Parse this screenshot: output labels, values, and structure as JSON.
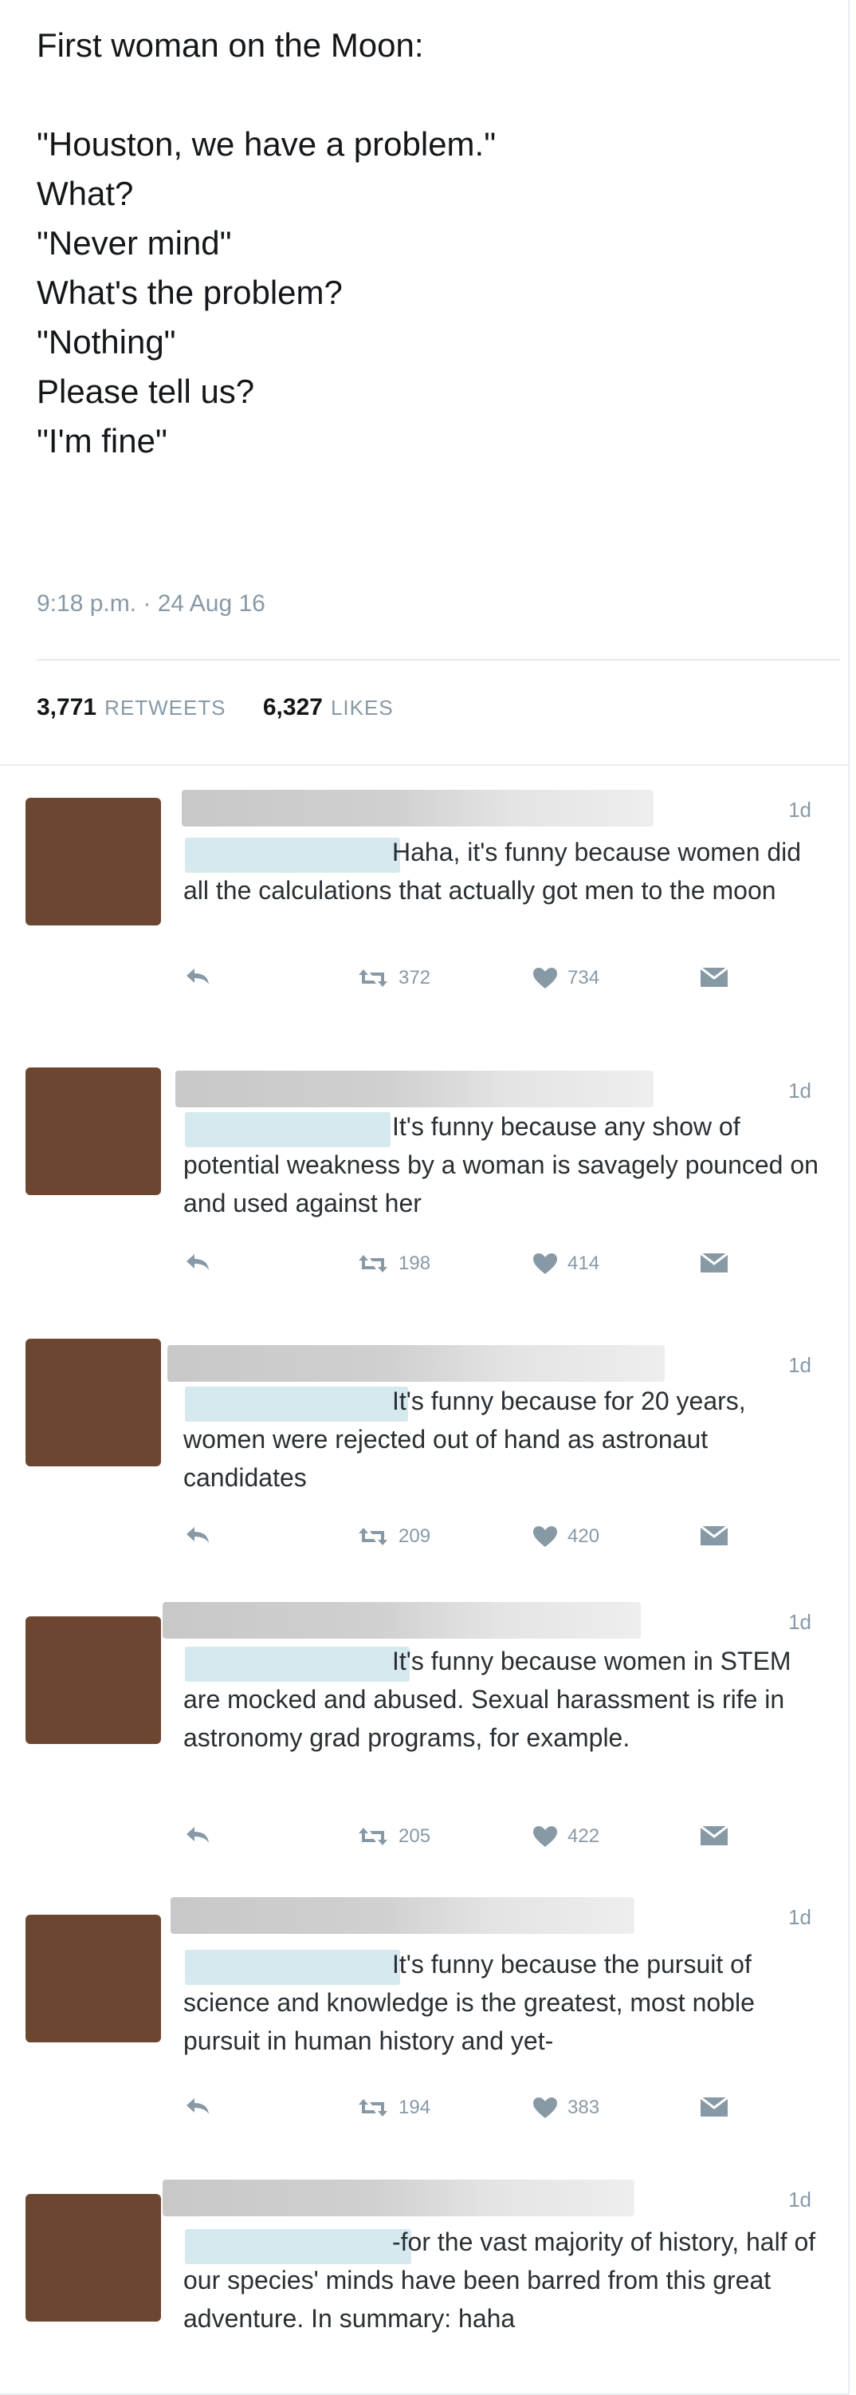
{
  "tweet": {
    "lines": [
      "First woman on the Moon:",
      "\"Houston, we have a problem.\"",
      "What?",
      "\"Never mind\"",
      "What's the problem?",
      "\"Nothing\"",
      "Please tell us?",
      "\"I'm fine\""
    ],
    "timestamp": "9:18 p.m. · 24 Aug 16",
    "retweets_count": "3,771",
    "retweets_label": "RETWEETS",
    "likes_count": "6,327",
    "likes_label": "LIKES"
  },
  "replies": [
    {
      "age": "1d",
      "text": "Haha, it's funny because women did all the calculations that actually got men to the moon",
      "retweets": "372",
      "likes": "734"
    },
    {
      "age": "1d",
      "text": "It's funny because any show of potential weakness by a woman is savagely pounced on and used against her",
      "retweets": "198",
      "likes": "414"
    },
    {
      "age": "1d",
      "text": "It's funny because for 20 years, women were rejected out of hand as astronaut candidates",
      "retweets": "209",
      "likes": "420"
    },
    {
      "age": "1d",
      "text": "It's funny because women in STEM are mocked and abused. Sexual harassment is rife in astronomy grad programs, for example.",
      "retweets": "205",
      "likes": "422"
    },
    {
      "age": "1d",
      "text": "It's funny because the pursuit of science and knowledge is the greatest, most noble pursuit in human history and yet-",
      "retweets": "194",
      "likes": "383"
    },
    {
      "age": "1d",
      "text": "-for the vast majority of history, half of our species' minds have been barred from this great adventure. In summary: haha",
      "retweets": "",
      "likes": ""
    }
  ],
  "icons": {
    "reply": "reply-icon",
    "retweet": "retweet-icon",
    "like": "heart-icon",
    "message": "envelope-icon"
  },
  "colors": {
    "text": "#14171a",
    "muted": "#8899a6",
    "border": "#e6ecf0",
    "avatar": "#6d4631",
    "handle_blur": "#d6e9ef"
  }
}
